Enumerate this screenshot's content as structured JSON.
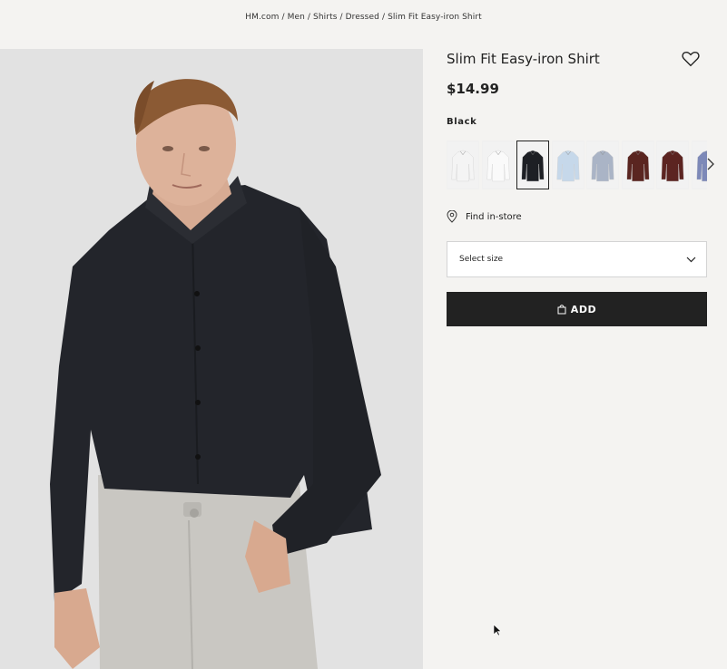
{
  "breadcrumb": [
    "HM.com",
    "Men",
    "Shirts",
    "Dressed",
    "Slim Fit Easy-iron Shirt"
  ],
  "breadcrumb_separator": "/",
  "product": {
    "title": "Slim Fit Easy-iron Shirt",
    "price": "$14.99",
    "selected_color": "Black",
    "image_icon": "model-photo-black-shirt"
  },
  "swatches": [
    {
      "name": "white-pattern",
      "color": "#f4f4f4",
      "selected": false
    },
    {
      "name": "white",
      "color": "#fafafa",
      "selected": false
    },
    {
      "name": "black",
      "color": "#1d1f24",
      "selected": true
    },
    {
      "name": "light-blue",
      "color": "#c6d8ea",
      "selected": false
    },
    {
      "name": "blue-pattern",
      "color": "#aab4c6",
      "selected": false
    },
    {
      "name": "dark-red",
      "color": "#5a2520",
      "selected": false
    },
    {
      "name": "burgundy",
      "color": "#5c2421",
      "selected": false
    },
    {
      "name": "blue-check",
      "color": "#7d89b8",
      "selected": false
    }
  ],
  "find_in_store": "Find in-store",
  "size_select": {
    "label": "Select size"
  },
  "add_button": {
    "label": "ADD"
  },
  "colors": {
    "background": "#f4f3f1",
    "button": "#222222",
    "text": "#222222"
  }
}
